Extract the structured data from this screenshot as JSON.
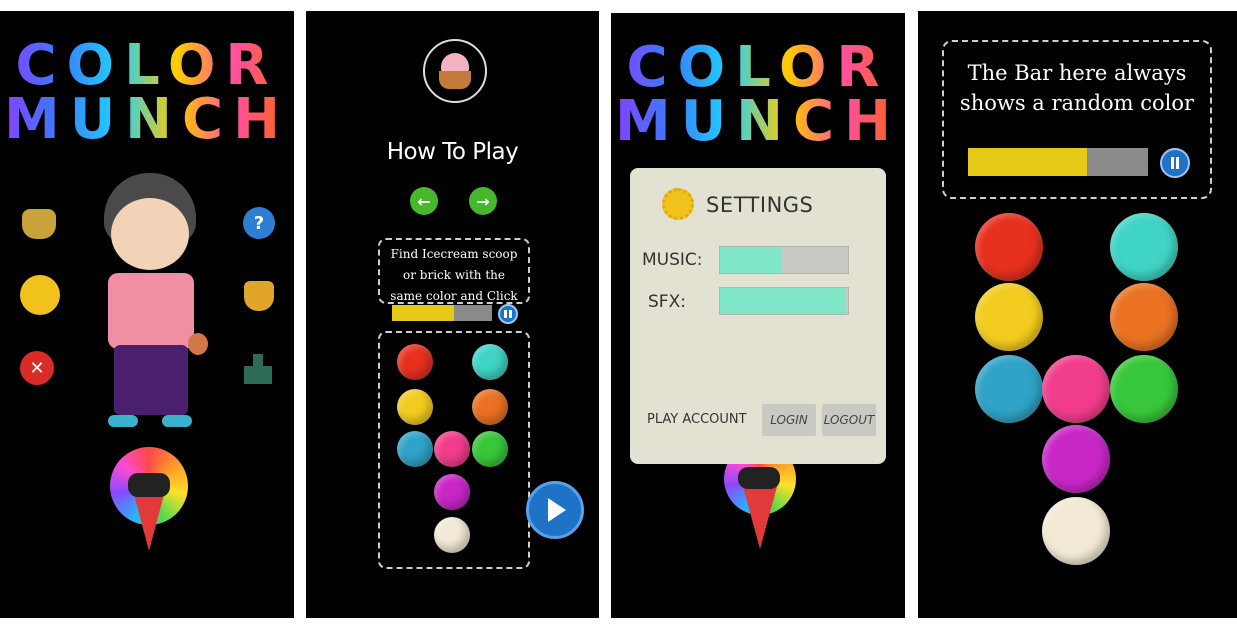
{
  "screen1": {
    "logo_line1": "COLOR",
    "logo_line2": "MUNCH",
    "left_icons": [
      "bell-icon",
      "gear-icon",
      "close-icon"
    ],
    "right_icons": [
      "help-icon",
      "trophy-icon",
      "leaderboard-icon"
    ],
    "help_glyph": "?",
    "close_glyph": "✕"
  },
  "screen2": {
    "title": "How To Play",
    "instruction": "Find Icecream scoop or brick with the same color and Click",
    "bar_progress": 0.62,
    "bar_color": "#e6c817",
    "balls": [
      {
        "color": "#e8301f"
      },
      {
        "color": "#3fd4c4"
      },
      {
        "color": "#f3cc1f"
      },
      {
        "color": "#ea7222"
      },
      {
        "color": "#2fa3c8"
      },
      {
        "color": "#f23d8c"
      },
      {
        "color": "#38c73a"
      },
      {
        "color": "#c827c6"
      },
      {
        "color": "#f2ead6"
      }
    ]
  },
  "screen3": {
    "logo_line1": "COLOR",
    "logo_line2": "MUNCH",
    "settings_title": "SETTINGS",
    "music_label": "MUSIC:",
    "music_level": 0.48,
    "sfx_label": "SFX:",
    "sfx_level": 0.98,
    "play_account_label": "PLAY ACCOUNT",
    "login_label": "LOGIN",
    "logout_label": "LOGOUT"
  },
  "screen4": {
    "caption": "The Bar here always shows a random color",
    "bar_progress": 0.66,
    "bar_color": "#e6c817"
  }
}
